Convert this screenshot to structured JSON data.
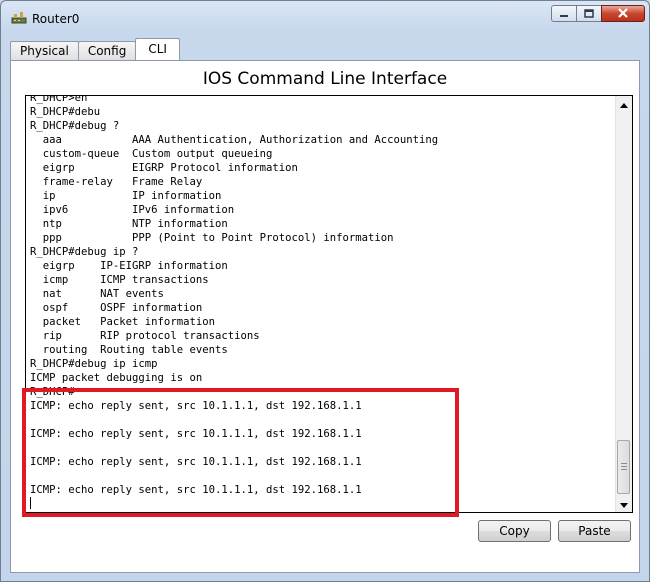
{
  "window": {
    "title": "Router0",
    "icons": {
      "app": "router-icon",
      "minimize": "minimize-icon",
      "maximize": "maximize-icon",
      "close": "close-icon"
    }
  },
  "tabs": [
    {
      "label": "Physical",
      "active": false
    },
    {
      "label": "Config",
      "active": false
    },
    {
      "label": "CLI",
      "active": true
    }
  ],
  "cli": {
    "heading": "IOS Command Line Interface",
    "lines": [
      "R_DHCP>en",
      "R_DHCP#debu",
      "R_DHCP#debug ?",
      "  aaa           AAA Authentication, Authorization and Accounting",
      "  custom-queue  Custom output queueing",
      "  eigrp         EIGRP Protocol information",
      "  frame-relay   Frame Relay",
      "  ip            IP information",
      "  ipv6          IPv6 information",
      "  ntp           NTP information",
      "  ppp           PPP (Point to Point Protocol) information",
      "R_DHCP#debug ip ?",
      "  eigrp    IP-EIGRP information",
      "  icmp     ICMP transactions",
      "  nat      NAT events",
      "  ospf     OSPF information",
      "  packet   Packet information",
      "  rip      RIP protocol transactions",
      "  routing  Routing table events",
      "R_DHCP#debug ip icmp",
      "ICMP packet debugging is on",
      "R_DHCP#",
      "ICMP: echo reply sent, src 10.1.1.1, dst 192.168.1.1",
      "",
      "ICMP: echo reply sent, src 10.1.1.1, dst 192.168.1.1",
      "",
      "ICMP: echo reply sent, src 10.1.1.1, dst 192.168.1.1",
      "",
      "ICMP: echo reply sent, src 10.1.1.1, dst 192.168.1.1",
      ""
    ],
    "scroll_position": 0.92
  },
  "buttons": {
    "copy": "Copy",
    "paste": "Paste"
  },
  "colors": {
    "highlight": "#e01a22",
    "window_frame": "#c4d4ea",
    "close_button": "#c9462e"
  }
}
